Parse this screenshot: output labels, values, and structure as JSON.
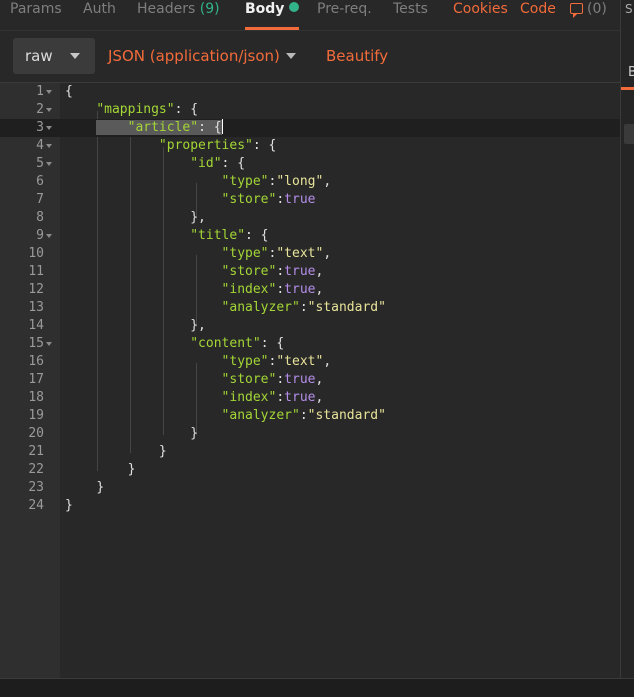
{
  "tabs": {
    "params": "Params",
    "auth": "Auth",
    "headers": "Headers",
    "headers_count": "(9)",
    "body": "Body",
    "prereq": "Pre-req.",
    "tests": "Tests",
    "cookies": "Cookies",
    "code": "Code",
    "comments_count": "(0)"
  },
  "side_panel": {
    "top_letter": "S",
    "tab_letter": "B"
  },
  "toolbar": {
    "body_type": "raw",
    "content_type": "JSON (application/json)",
    "beautify": "Beautify"
  },
  "editor": {
    "current_line": 3,
    "lines": [
      {
        "n": "1"
      },
      {
        "n": "2"
      },
      {
        "n": "3"
      },
      {
        "n": "4"
      },
      {
        "n": "5"
      },
      {
        "n": "6"
      },
      {
        "n": "7"
      },
      {
        "n": "8"
      },
      {
        "n": "9"
      },
      {
        "n": "10"
      },
      {
        "n": "11"
      },
      {
        "n": "12"
      },
      {
        "n": "13"
      },
      {
        "n": "14"
      },
      {
        "n": "15"
      },
      {
        "n": "16"
      },
      {
        "n": "17"
      },
      {
        "n": "18"
      },
      {
        "n": "19"
      },
      {
        "n": "20"
      },
      {
        "n": "21"
      },
      {
        "n": "22"
      },
      {
        "n": "23"
      },
      {
        "n": "24"
      }
    ],
    "tokens": {
      "mappings": "\"mappings\"",
      "article": "\"article\"",
      "properties": "\"properties\"",
      "id": "\"id\"",
      "title": "\"title\"",
      "content": "\"content\"",
      "type": "\"type\"",
      "store": "\"store\"",
      "index": "\"index\"",
      "analyzer": "\"analyzer\"",
      "long": "\"long\"",
      "text": "\"text\"",
      "standard": "\"standard\"",
      "true": "true"
    }
  },
  "colors": {
    "accent": "#f26b3a",
    "success": "#32b38a",
    "key": "#a3d636",
    "string": "#e8e39a",
    "boolean": "#b48ee8"
  }
}
